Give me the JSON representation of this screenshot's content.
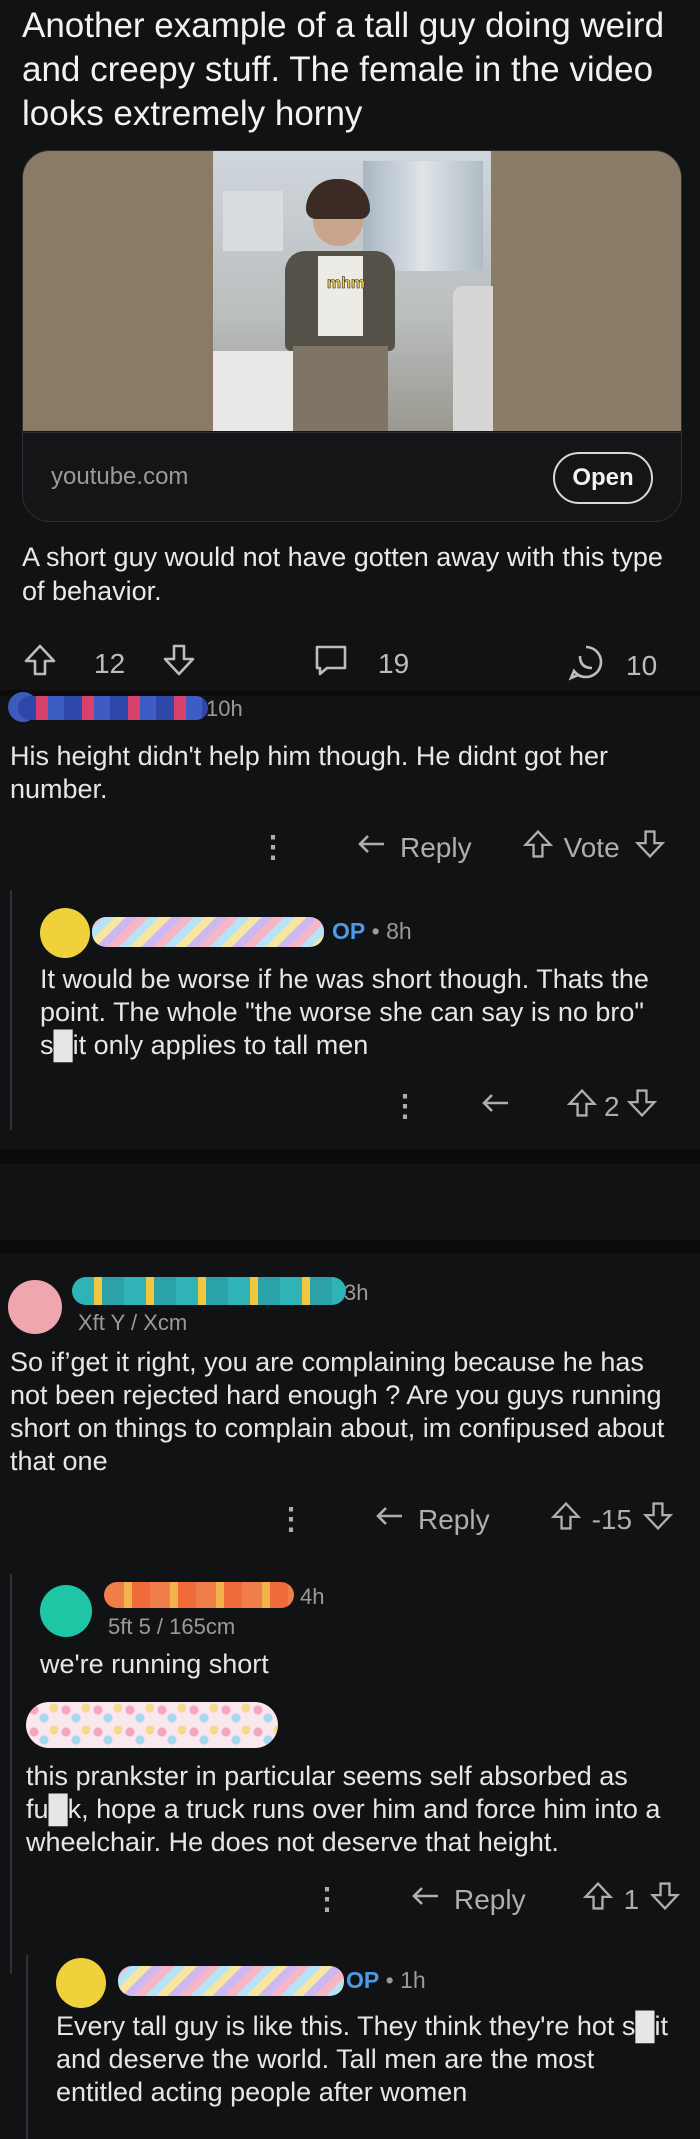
{
  "post": {
    "title": "Another example of a tall guy doing weird and creepy stuff. The female in the video looks extremely horny",
    "media_caption": "mhm",
    "link_domain": "youtube.com",
    "open_label": "Open",
    "body": "A short guy would not have gotten away with this type of behavior.",
    "upvotes": "12",
    "comments": "19",
    "shares": "10"
  },
  "comments": [
    {
      "time": "10h",
      "text": "His height didn't help him though. He didnt got her number.",
      "reply_label": "Reply",
      "vote_label": "Vote"
    },
    {
      "op_tag": "OP",
      "time": "• 8h",
      "text": "It would be worse if he was short though. Thats the point. The whole \"the worse she can say is no bro\" s█it only applies to tall men",
      "score": "2"
    },
    {
      "time": "3h",
      "flair": "Xft Y / Xcm",
      "text": "So if’get it right, you are complaining because he has not been rejected hard enough ? Are you guys running short on things to complain about, im confipused about that one",
      "reply_label": "Reply",
      "score": "-15"
    },
    {
      "time": "4h",
      "flair": "5ft 5 / 165cm",
      "text": "we're running short"
    },
    {
      "text": "this prankster in particular seems self absorbed as fu█k, hope a truck runs over him and force him into a wheelchair. He does not deserve that height.",
      "reply_label": "Reply",
      "score": "1"
    },
    {
      "op_tag": "OP",
      "time": "• 1h",
      "text": "Every tall guy is like this. They think they're hot s█it and deserve the world. Tall men are the most entitled acting people after women"
    }
  ],
  "colors": {
    "op_blue": "#4d9be6",
    "background": "#111213",
    "text": "#e6e6e6",
    "muted": "#9a9a9a"
  }
}
